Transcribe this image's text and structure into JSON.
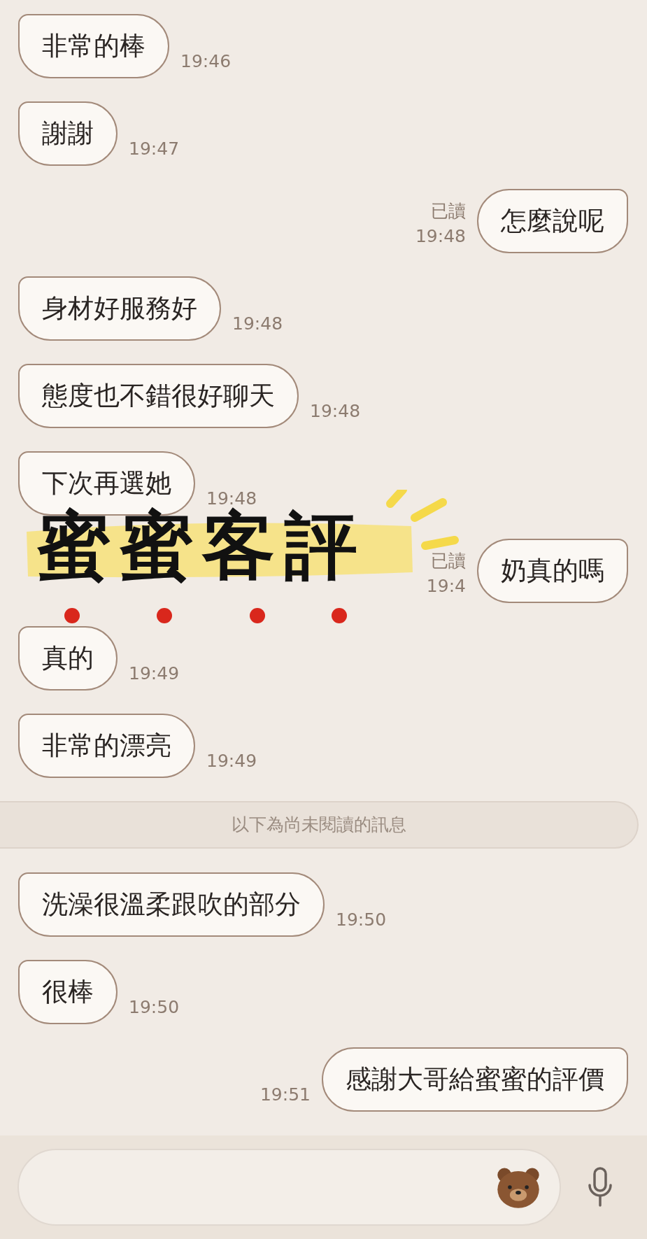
{
  "messages": [
    {
      "kind": "message",
      "outgoing": false,
      "text": "非常的棒",
      "time": "19:46"
    },
    {
      "kind": "message",
      "outgoing": false,
      "text": "謝謝",
      "time": "19:47"
    },
    {
      "kind": "message",
      "outgoing": true,
      "text": "怎麼說呢",
      "read": "已讀",
      "time": "19:48"
    },
    {
      "kind": "message",
      "outgoing": false,
      "text": "身材好服務好",
      "time": "19:48"
    },
    {
      "kind": "message",
      "outgoing": false,
      "text": "態度也不錯很好聊天",
      "time": "19:48"
    },
    {
      "kind": "message",
      "outgoing": false,
      "text": "下次再選她",
      "time": "19:48"
    },
    {
      "kind": "message",
      "outgoing": true,
      "text": "奶真的嗎",
      "read": "已讀",
      "time": "19:4"
    },
    {
      "kind": "message",
      "outgoing": false,
      "text": "真的",
      "time": "19:49"
    },
    {
      "kind": "message",
      "outgoing": false,
      "text": "非常的漂亮",
      "time": "19:49"
    },
    {
      "kind": "divider",
      "text": "以下為尚未閱讀的訊息"
    },
    {
      "kind": "message",
      "outgoing": false,
      "text": "洗澡很溫柔跟吹的部分",
      "time": "19:50"
    },
    {
      "kind": "message",
      "outgoing": false,
      "text": "很棒",
      "time": "19:50"
    },
    {
      "kind": "message",
      "outgoing": true,
      "text": "感謝大哥給蜜蜜的評價",
      "time": "19:51"
    }
  ],
  "overlay": {
    "title": "蜜蜜客評"
  }
}
